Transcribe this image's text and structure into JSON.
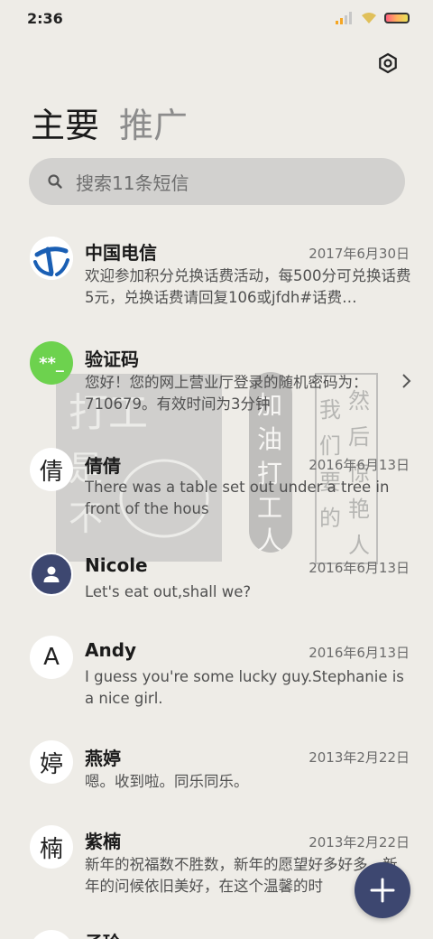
{
  "status": {
    "time": "2:36"
  },
  "tabs": {
    "main": "主要",
    "promo": "推广"
  },
  "search": {
    "placeholder": "搜索11条短信"
  },
  "messages": [
    {
      "name": "中国电信",
      "date": "2017年6月30日",
      "preview": "欢迎参加积分兑换话费活动，每500分可兑换话费5元，兑换话费请回复106或jfdh#话费…",
      "avatar": "china-telecom-logo"
    },
    {
      "name": "验证码",
      "date": "",
      "preview": "您好！您的网上营业厅登录的随机密码为：710679。有效时间为3分钟",
      "avatar": "**_"
    },
    {
      "name": "倩倩",
      "date": "2016年6月13日",
      "preview": "There was a table set out under a tree in front of the hous",
      "avatar": "倩"
    },
    {
      "name": "Nicole",
      "date": "2016年6月13日",
      "preview": "Let's eat out,shall we?",
      "avatar": "person-icon"
    },
    {
      "name": "Andy",
      "date": "2016年6月13日",
      "preview": "I guess you're some lucky guy.Stephanie is a nice girl.",
      "avatar": "A"
    },
    {
      "name": "燕婷",
      "date": "2013年2月22日",
      "preview": "嗯。收到啦。同乐同乐。",
      "avatar": "婷"
    },
    {
      "name": "紫楠",
      "date": "2013年2月22日",
      "preview": "新年的祝福数不胜数，新年的愿望好多好多，新年的问候依旧美好，在这个温馨的时",
      "avatar": "楠"
    },
    {
      "name": "子玲",
      "date": "",
      "preview": "",
      "avatar": ""
    }
  ],
  "watermark": {
    "left_text": "打工是不可能打工",
    "mid_text": "加油打工人",
    "right_col1": "我们要搬砖的打工",
    "right_col2": "然后惊艳所有人"
  },
  "colors": {
    "background": "#eeece7",
    "fab": "#3d4770",
    "verify_avatar": "#6dd24e",
    "telecom_blue": "#1a5fb4"
  }
}
